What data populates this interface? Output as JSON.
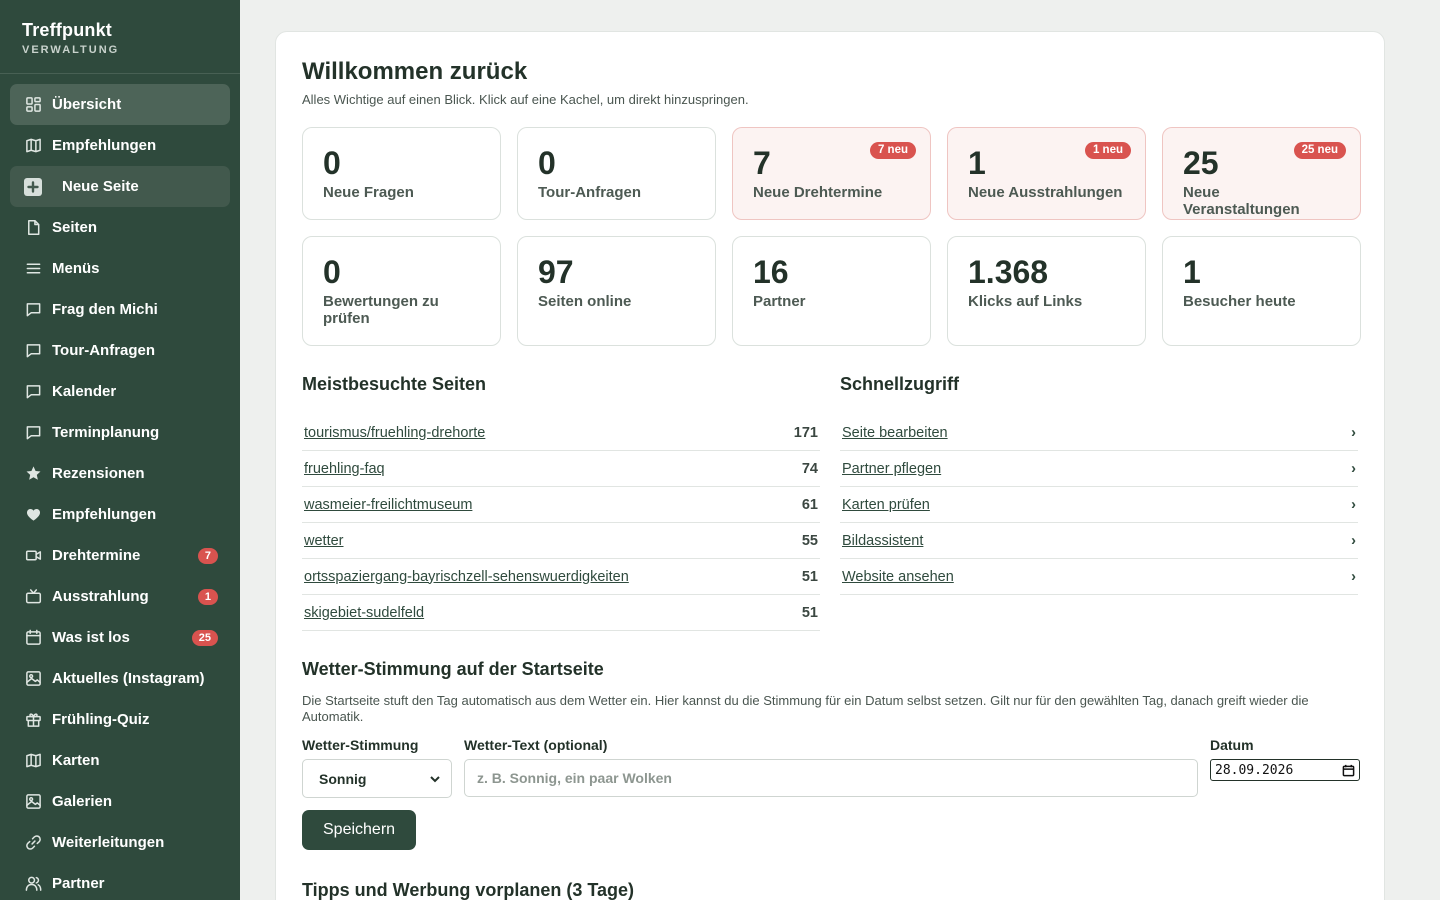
{
  "brand": {
    "title": "Treffpunkt",
    "subtitle": "VERWALTUNG"
  },
  "sidebar": {
    "items": [
      {
        "label": "Übersicht",
        "icon": "dashboard-icon",
        "active": true
      },
      {
        "label": "Empfehlungen",
        "icon": "map-icon"
      },
      {
        "label": "Neue Seite",
        "icon": "plus-icon",
        "highlight": true
      },
      {
        "label": "Seiten",
        "icon": "page-icon"
      },
      {
        "label": "Menüs",
        "icon": "menu-icon"
      },
      {
        "label": "Frag den Michi",
        "icon": "chat-icon"
      },
      {
        "label": "Tour-Anfragen",
        "icon": "chat-icon"
      },
      {
        "label": "Kalender",
        "icon": "chat-icon"
      },
      {
        "label": "Terminplanung",
        "icon": "chat-icon"
      },
      {
        "label": "Rezensionen",
        "icon": "star-icon"
      },
      {
        "label": "Empfehlungen",
        "icon": "heart-icon"
      },
      {
        "label": "Drehtermine",
        "icon": "video-icon",
        "badge": "7"
      },
      {
        "label": "Ausstrahlung",
        "icon": "tv-icon",
        "badge": "1"
      },
      {
        "label": "Was ist los",
        "icon": "calendar-icon",
        "badge": "25"
      },
      {
        "label": "Aktuelles (Instagram)",
        "icon": "image-icon"
      },
      {
        "label": "Frühling-Quiz",
        "icon": "gift-icon"
      },
      {
        "label": "Karten",
        "icon": "map-icon"
      },
      {
        "label": "Galerien",
        "icon": "image-icon"
      },
      {
        "label": "Weiterleitungen",
        "icon": "link-icon"
      },
      {
        "label": "Partner",
        "icon": "users-icon"
      }
    ]
  },
  "main": {
    "title": "Willkommen zurück",
    "subtitle": "Alles Wichtige auf einen Blick. Klick auf eine Kachel, um direkt hinzuspringen.",
    "tiles_row1": [
      {
        "num": "0",
        "label": "Neue Fragen"
      },
      {
        "num": "0",
        "label": "Tour-Anfragen"
      },
      {
        "num": "7",
        "label": "Neue Drehtermine",
        "badge": "7 neu"
      },
      {
        "num": "1",
        "label": "Neue Ausstrahlungen",
        "badge": "1 neu"
      },
      {
        "num": "25",
        "label": "Neue Veranstaltungen",
        "badge": "25 neu"
      }
    ],
    "tiles_row2": [
      {
        "num": "0",
        "label": "Bewertungen zu prüfen"
      },
      {
        "num": "97",
        "label": "Seiten online"
      },
      {
        "num": "16",
        "label": "Partner"
      },
      {
        "num": "1.368",
        "label": "Klicks auf Links"
      },
      {
        "num": "1",
        "label": "Besucher heute"
      }
    ],
    "top_pages": {
      "title": "Meistbesuchte Seiten",
      "rows": [
        {
          "path": "tourismus/fruehling-drehorte",
          "count": "171"
        },
        {
          "path": "fruehling-faq",
          "count": "74"
        },
        {
          "path": "wasmeier-freilichtmuseum",
          "count": "61"
        },
        {
          "path": "wetter",
          "count": "55"
        },
        {
          "path": "ortsspaziergang-bayrischzell-sehenswuerdigkeiten",
          "count": "51"
        },
        {
          "path": "skigebiet-sudelfeld",
          "count": "51"
        }
      ]
    },
    "quick": {
      "title": "Schnellzugriff",
      "chevron": "›",
      "rows": [
        "Seite bearbeiten",
        "Partner pflegen",
        "Karten prüfen",
        "Bildassistent",
        "Website ansehen"
      ]
    },
    "weather": {
      "title": "Wetter-Stimmung auf der Startseite",
      "description": "Die Startseite stuft den Tag automatisch aus dem Wetter ein. Hier kannst du die Stimmung für ein Datum selbst setzen. Gilt nur für den gewählten Tag, danach greift wieder die Automatik.",
      "mood_label": "Wetter-Stimmung",
      "mood_value": "Sonnig",
      "text_label": "Wetter-Text (optional)",
      "text_placeholder": "z. B. Sonnig, ein paar Wolken",
      "date_label": "Datum",
      "date_value": "28.09.2026",
      "save_label": "Speichern"
    },
    "tips_title": "Tipps und Werbung vorplanen (3 Tage)"
  },
  "colors": {
    "sidebar": "#2f4a3d",
    "accent": "#2f4a3d",
    "badge": "#d9534f",
    "alert_tile": "#fcf3f2"
  }
}
